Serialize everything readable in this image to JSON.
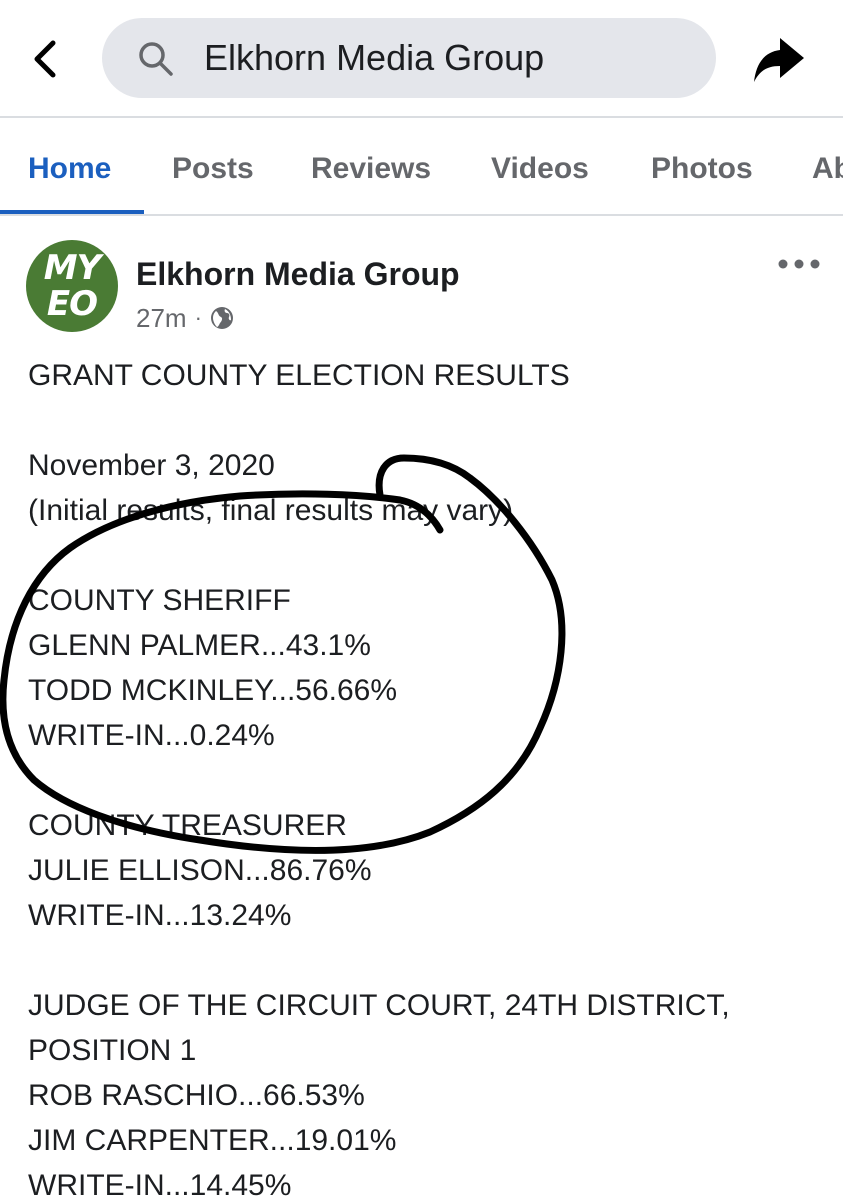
{
  "search": {
    "query": "Elkhorn Media Group"
  },
  "tabs": [
    {
      "label": "Home",
      "active": true
    },
    {
      "label": "Posts",
      "active": false
    },
    {
      "label": "Reviews",
      "active": false
    },
    {
      "label": "Videos",
      "active": false
    },
    {
      "label": "Photos",
      "active": false
    },
    {
      "label": "Ab",
      "active": false
    }
  ],
  "post": {
    "avatar_line1": "MY",
    "avatar_line2": "EO",
    "author": "Elkhorn Media Group",
    "time": "27m",
    "separator": "·",
    "lines": [
      "GRANT COUNTY ELECTION RESULTS",
      "November 3, 2020",
      "(Initial results, final results may vary)",
      "COUNTY SHERIFF",
      "GLENN PALMER...43.1%",
      "TODD MCKINLEY...56.66%",
      "WRITE-IN...0.24%",
      "COUNTY TREASURER",
      "JULIE ELLISON...86.76%",
      "WRITE-IN...13.24%",
      "JUDGE OF THE CIRCUIT COURT, 24TH DISTRICT,",
      "POSITION 1",
      "ROB RASCHIO...66.53%",
      "JIM CARPENTER...19.01%",
      "WRITE-IN...14.45%"
    ]
  },
  "colors": {
    "accent": "#1b5fbf",
    "avatar_bg": "#4a7b34",
    "secondary_text": "#65676b",
    "search_bg": "#e4e6eb",
    "annotation": "#000000"
  },
  "icons": {
    "back": "chevron-left-icon",
    "search": "magnifier-icon",
    "share": "share-arrow-icon",
    "audience": "globe-icon",
    "more": "ellipsis-icon"
  }
}
